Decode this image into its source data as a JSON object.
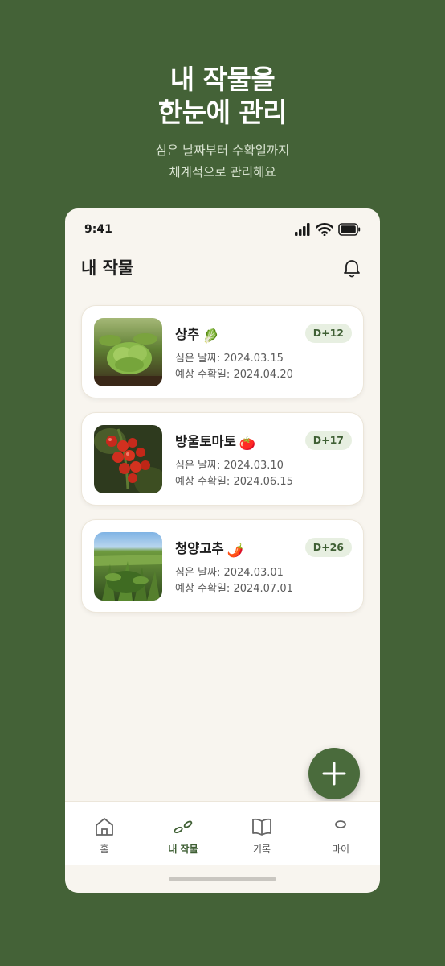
{
  "hero": {
    "title_line1": "내 작물을",
    "title_line2": "한눈에 관리",
    "sub_line1": "심은 날짜부터 수확일까지",
    "sub_line2": "체계적으로 관리해요"
  },
  "status": {
    "time": "9:41"
  },
  "header": {
    "title": "내 작물",
    "bell_icon": "bell-icon"
  },
  "crops": [
    {
      "name": "상추",
      "emoji": "🥬",
      "planted": "심은 날짜: 2024.03.15",
      "harvest": "예상 수확일: 2024.04.20",
      "dday": "D+12"
    },
    {
      "name": "방울토마토",
      "emoji": "🍅",
      "planted": "심은 날짜: 2024.03.10",
      "harvest": "예상 수확일: 2024.06.15",
      "dday": "D+17"
    },
    {
      "name": "청양고추",
      "emoji": "🌶️",
      "planted": "심은 날짜: 2024.03.01",
      "harvest": "예상 수확일: 2024.07.01",
      "dday": "D+26"
    }
  ],
  "fab": {
    "icon": "plus-icon"
  },
  "nav": {
    "home": "홈",
    "crops": "내 작물",
    "records": "기록",
    "my": "마이"
  },
  "colors": {
    "brand": "#446237",
    "accent": "#4a6b3c",
    "badge_bg": "#e7efe1"
  }
}
